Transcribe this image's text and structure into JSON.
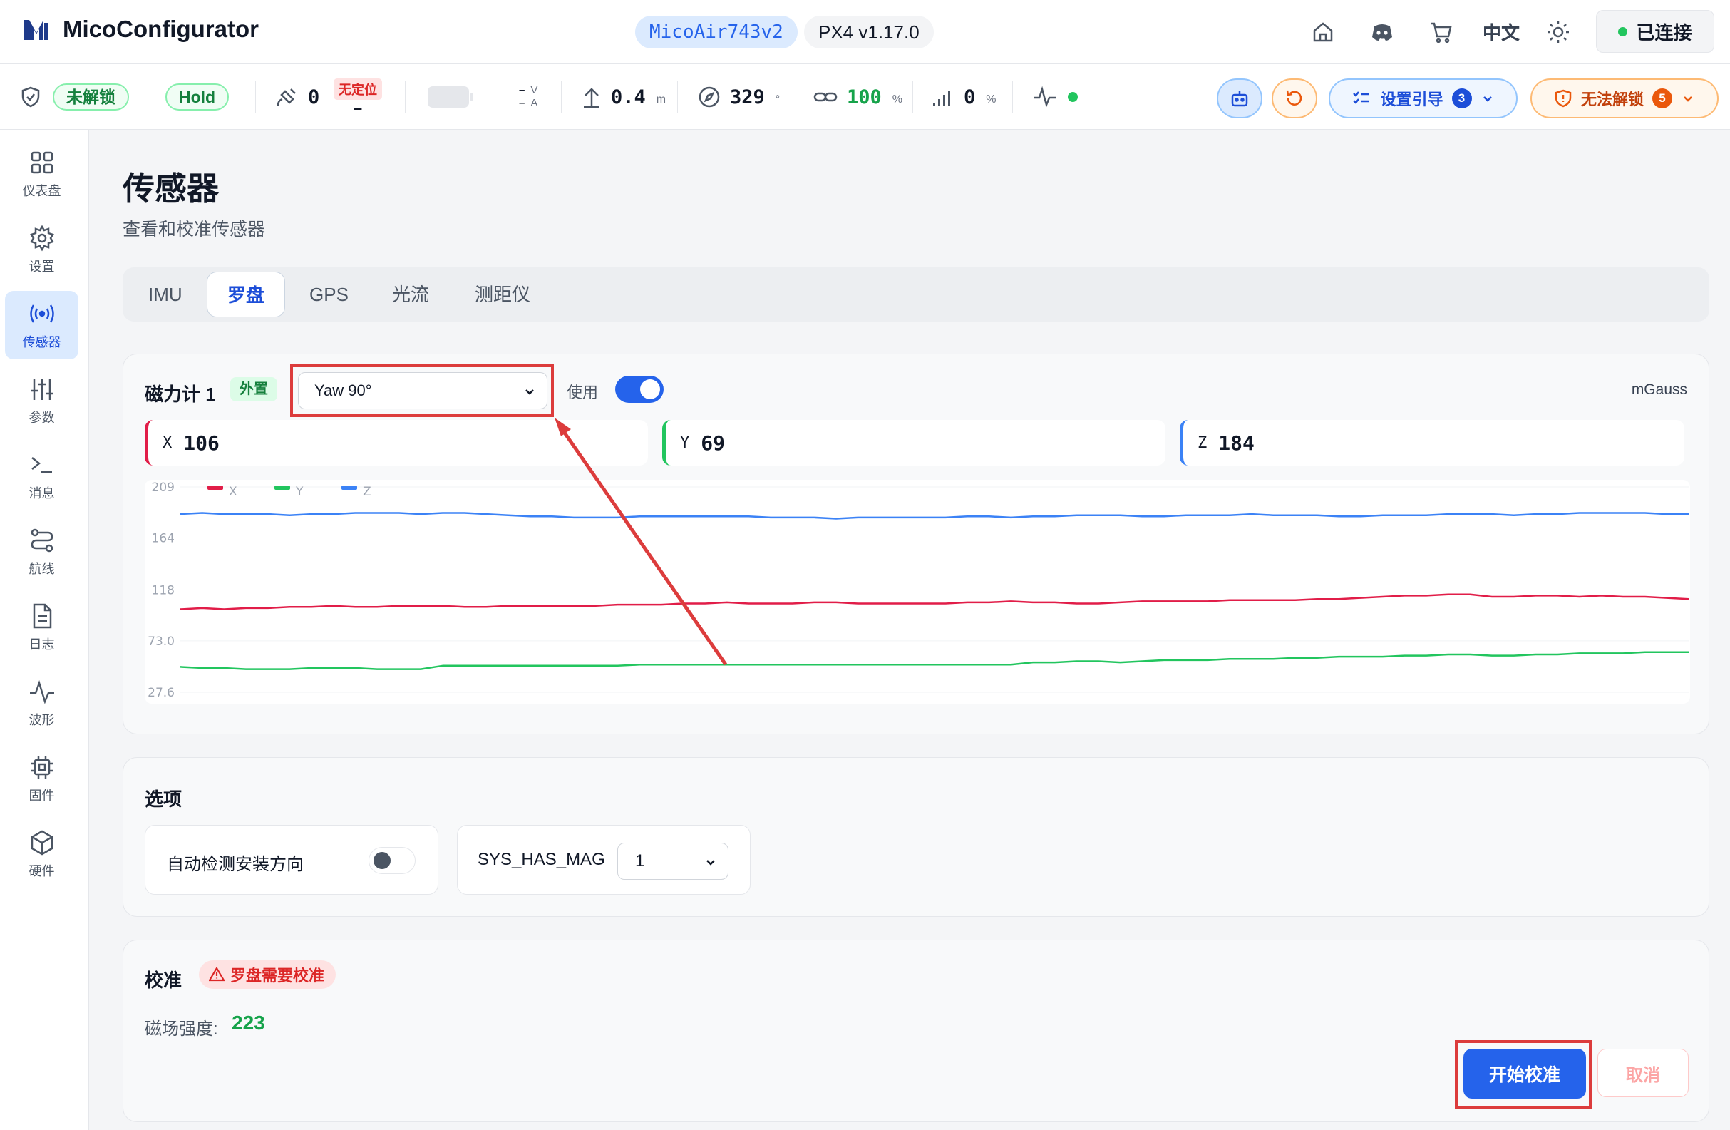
{
  "app": {
    "title": "MicoConfigurator",
    "board": "MicoAir743v2",
    "firmware": "PX4 v1.17.0",
    "language": "中文",
    "connection": "已连接"
  },
  "status": {
    "arm_state": "未解锁",
    "mode": "Hold",
    "satellites": "0",
    "gps_fix": "无定位",
    "gps_dash": "–",
    "voltage_unit": "V",
    "current_unit": "A",
    "altitude": "0.4",
    "altitude_unit": "m",
    "heading": "329",
    "heading_unit": "°",
    "link_quality": "100",
    "link_unit": "%",
    "signal": "0",
    "signal_unit": "%",
    "setup_guide": "设置引导",
    "setup_guide_count": "3",
    "cannot_arm": "无法解锁",
    "cannot_arm_count": "5"
  },
  "sidebar": {
    "items": [
      {
        "label": "仪表盘",
        "icon": "dashboard-icon"
      },
      {
        "label": "设置",
        "icon": "gear-icon"
      },
      {
        "label": "传感器",
        "icon": "sensor-icon"
      },
      {
        "label": "参数",
        "icon": "sliders-icon"
      },
      {
        "label": "消息",
        "icon": "terminal-icon"
      },
      {
        "label": "航线",
        "icon": "route-icon"
      },
      {
        "label": "日志",
        "icon": "file-icon"
      },
      {
        "label": "波形",
        "icon": "waveform-icon"
      },
      {
        "label": "固件",
        "icon": "chip-icon"
      },
      {
        "label": "硬件",
        "icon": "cube-icon"
      }
    ],
    "active": 2
  },
  "page": {
    "title": "传感器",
    "subtitle": "查看和校准传感器",
    "tabs": [
      "IMU",
      "罗盘",
      "GPS",
      "光流",
      "测距仪"
    ],
    "active_tab": 1
  },
  "magnetometer": {
    "title": "磁力计 1",
    "tag": "外置",
    "orientation": "Yaw 90°",
    "use_label": "使用",
    "use_enabled": true,
    "unit": "mGauss",
    "axes": [
      {
        "label": "X",
        "value": "106",
        "color": "#e11d48"
      },
      {
        "label": "Y",
        "value": "69",
        "color": "#22c55e"
      },
      {
        "label": "Z",
        "value": "184",
        "color": "#3b82f6"
      }
    ]
  },
  "chart_data": {
    "type": "line",
    "title": "",
    "xlabel": "",
    "ylabel": "",
    "ylim": [
      27.6,
      209
    ],
    "y_ticks": [
      "209",
      "164",
      "118",
      "73.0",
      "27.6"
    ],
    "legend": "top-left",
    "grid": true,
    "series": [
      {
        "name": "X",
        "color": "#e11d48",
        "values": [
          101,
          102,
          101,
          102,
          102,
          103,
          103,
          104,
          103,
          103,
          104,
          104,
          104,
          103,
          103,
          104,
          104,
          104,
          104,
          104,
          105,
          105,
          105,
          106,
          106,
          107,
          106,
          106,
          106,
          107,
          107,
          106,
          106,
          106,
          106,
          106,
          107,
          107,
          108,
          107,
          107,
          106,
          106,
          107,
          108,
          108,
          108,
          108,
          109,
          109,
          109,
          109,
          110,
          110,
          111,
          112,
          113,
          113,
          114,
          114,
          112,
          112,
          113,
          113,
          112,
          113,
          112,
          112,
          111,
          110
        ]
      },
      {
        "name": "Y",
        "color": "#22c55e",
        "values": [
          50,
          49,
          49,
          48,
          48,
          48,
          49,
          49,
          49,
          48,
          48,
          48,
          51,
          51,
          51,
          51,
          51,
          51,
          51,
          51,
          51,
          52,
          52,
          52,
          52,
          52,
          52,
          52,
          52,
          52,
          52,
          52,
          52,
          52,
          52,
          52,
          52,
          52,
          52,
          54,
          54,
          55,
          55,
          54,
          55,
          56,
          56,
          56,
          57,
          57,
          57,
          58,
          58,
          59,
          59,
          59,
          60,
          60,
          61,
          61,
          60,
          60,
          61,
          61,
          62,
          62,
          62,
          63,
          63,
          63
        ]
      },
      {
        "name": "Z",
        "color": "#3b82f6",
        "values": [
          185,
          186,
          185,
          185,
          185,
          184,
          185,
          185,
          186,
          186,
          186,
          185,
          186,
          186,
          185,
          184,
          183,
          183,
          182,
          182,
          182,
          183,
          183,
          183,
          183,
          183,
          183,
          182,
          182,
          182,
          181,
          182,
          182,
          182,
          182,
          182,
          183,
          183,
          182,
          183,
          183,
          184,
          184,
          184,
          183,
          183,
          184,
          184,
          184,
          185,
          184,
          184,
          184,
          183,
          183,
          184,
          184,
          184,
          185,
          185,
          185,
          184,
          185,
          185,
          186,
          186,
          186,
          186,
          185,
          185
        ]
      }
    ]
  },
  "options": {
    "title": "选项",
    "auto_detect_label": "自动检测安装方向",
    "auto_detect_enabled": false,
    "sys_has_mag_label": "SYS_HAS_MAG",
    "sys_has_mag_value": "1"
  },
  "calibration": {
    "title": "校准",
    "warning": "罗盘需要校准",
    "field_strength_label": "磁场强度:",
    "field_strength_value": "223",
    "start_label": "开始校准",
    "cancel_label": "取消"
  },
  "colors": {
    "accent": "#2563eb",
    "highlight": "#dc3c3c",
    "success": "#16a34a",
    "warning": "#ea580c"
  }
}
